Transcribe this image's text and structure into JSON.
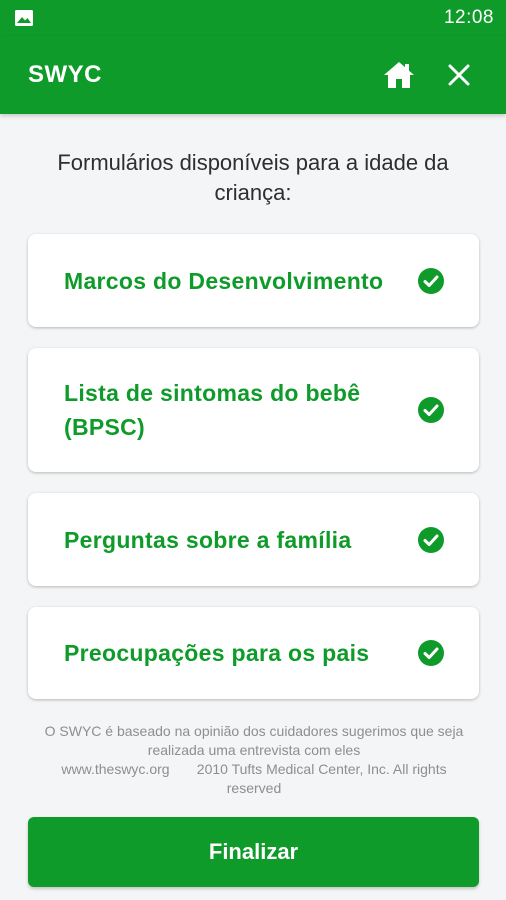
{
  "status_bar": {
    "time": "12:08"
  },
  "app_bar": {
    "title": "SWYC"
  },
  "heading": "Formulários disponíveis para a idade da criança:",
  "forms": [
    {
      "label": "Marcos do Desenvolvimento",
      "completed": true
    },
    {
      "label": "Lista de sintomas do bebê (BPSC)",
      "completed": true
    },
    {
      "label": "Perguntas sobre a família",
      "completed": true
    },
    {
      "label": "Preocupações para os pais",
      "completed": true
    }
  ],
  "footer": {
    "disclaimer": "O SWYC é baseado na opinião dos cuidadores sugerimos que seja realizada uma entrevista com eles",
    "website": "www.theswyc.org",
    "copyright": "2010 Tufts Medical Center, Inc. All rights reserved"
  },
  "finish_button": {
    "label": "Finalizar"
  },
  "colors": {
    "primary": "#0f9b2a",
    "background": "#f4f5f6",
    "muted_text": "#8e8e8e"
  }
}
